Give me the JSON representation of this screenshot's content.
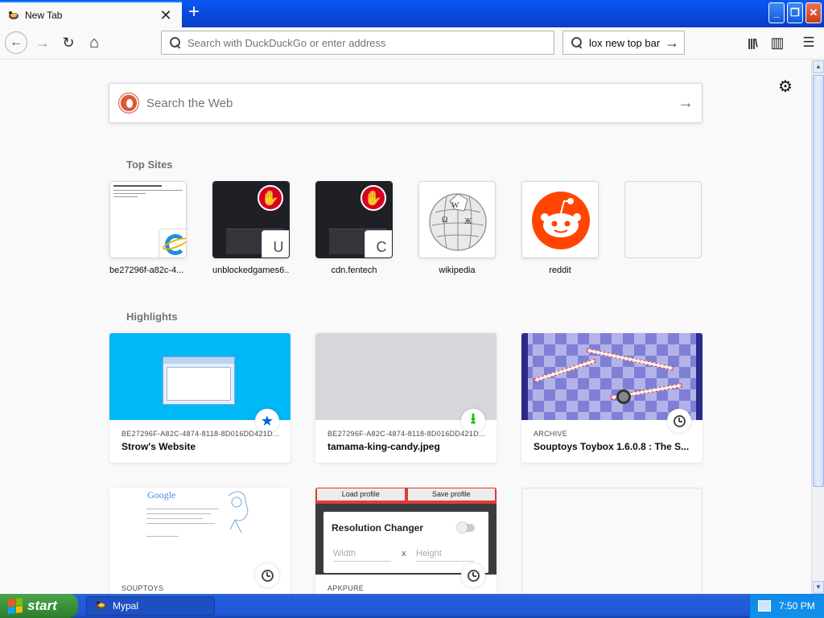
{
  "window": {
    "tab_title": "New Tab",
    "tab_close": "✕",
    "new_tab": "+",
    "minimize": "_",
    "maximize": "❐",
    "close": "✕"
  },
  "navbar": {
    "back": "←",
    "forward": "→",
    "reload": "↻",
    "home": "⌂",
    "url_placeholder": "Search with DuckDuckGo or enter address",
    "search_value": "lox new top bar",
    "search_go": "→",
    "library": "|||\\",
    "sidebar": "▥",
    "menu": "☰"
  },
  "newtab": {
    "settings": "⚙",
    "web_search_placeholder": "Search the Web",
    "web_search_go": "→",
    "top_sites_title": "Top Sites",
    "top_sites": [
      {
        "label": "be27296f-a82c-4...",
        "badge": ""
      },
      {
        "label": "unblockedgames6...",
        "badge": "U"
      },
      {
        "label": "cdn.fentech",
        "badge": "C"
      },
      {
        "label": "wikipedia",
        "badge": ""
      },
      {
        "label": "reddit",
        "badge": ""
      },
      {
        "label": "",
        "badge": ""
      }
    ],
    "highlights_title": "Highlights",
    "highlights": [
      {
        "meta": "BE27296F-A82C-4874-8118-8D016DD421D...",
        "title": "Strow's Website",
        "badge": "bookmark"
      },
      {
        "meta": "BE27296F-A82C-4874-8118-8D016DD421D...",
        "title": "tamama-king-candy.jpeg",
        "badge": "download"
      },
      {
        "meta": "ARCHIVE",
        "title": "Souptoys Toybox 1.6.0.8 : The S...",
        "badge": "history"
      },
      {
        "meta": "SOUPTOYS",
        "title": "",
        "badge": "history"
      },
      {
        "meta": "APKPURE",
        "title": "",
        "badge": "history"
      }
    ],
    "hl_preview": {
      "google": "Google",
      "load_profile": "Load profile",
      "save_profile": "Save profile",
      "resolution_changer": "Resolution Changer",
      "width": "Width",
      "x": "x",
      "height": "Height"
    }
  },
  "taskbar": {
    "start": "start",
    "task_label": "Mypal",
    "clock": "7:50 PM"
  },
  "colors": {
    "accent": "#0a84ff",
    "xp_blue": "#245edb",
    "start_green": "#3a923a",
    "reddit": "#ff4500",
    "ddg": "#de5833"
  }
}
